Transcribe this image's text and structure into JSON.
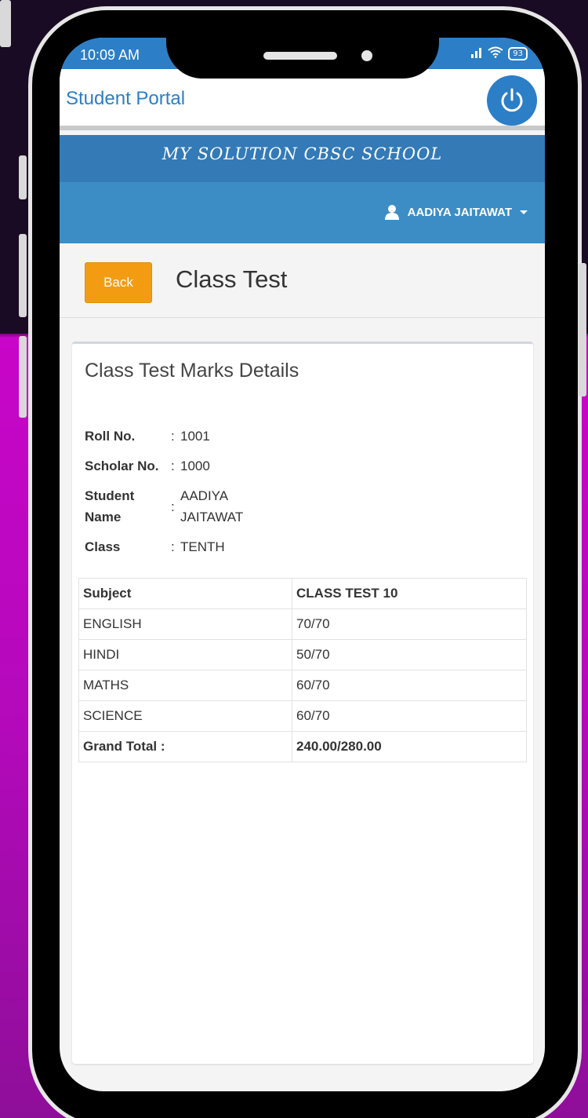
{
  "status_bar": {
    "time": "10:09 AM",
    "signal": "ıll",
    "wifi": "wifi",
    "battery": "93"
  },
  "app_bar": {
    "title": "Student Portal",
    "power_icon": "power-icon"
  },
  "school": {
    "name": "MY SOLUTION CBSC SCHOOL"
  },
  "user_menu": {
    "name": "AADIYA JAITAWAT",
    "icon": "user-icon"
  },
  "page": {
    "back_label": "Back",
    "title": "Class Test"
  },
  "card": {
    "title": "Class Test Marks Details",
    "info": {
      "roll_label": "Roll No.",
      "roll_value": "1001",
      "scholar_label": "Scholar No.",
      "scholar_value": "1000",
      "student_label_1": "Student",
      "student_label_2": "Name",
      "student_value_1": "AADIYA",
      "student_value_2": "JAITAWAT",
      "class_label": "Class",
      "class_value": "TENTH",
      "separator": ":"
    },
    "table": {
      "headers": [
        "Subject",
        "CLASS TEST 10"
      ],
      "rows": [
        {
          "subject": "ENGLISH",
          "marks": "70/70"
        },
        {
          "subject": "HINDI",
          "marks": "50/70"
        },
        {
          "subject": "MATHS",
          "marks": "60/70"
        },
        {
          "subject": "SCIENCE",
          "marks": "60/70"
        }
      ],
      "total_label": "Grand Total :",
      "total_value": "240.00/280.00"
    }
  },
  "colors": {
    "primary": "#2c7ec6",
    "school_band": "#337ab7",
    "user_band": "#3c8dc6",
    "back_button": "#f39c12"
  }
}
